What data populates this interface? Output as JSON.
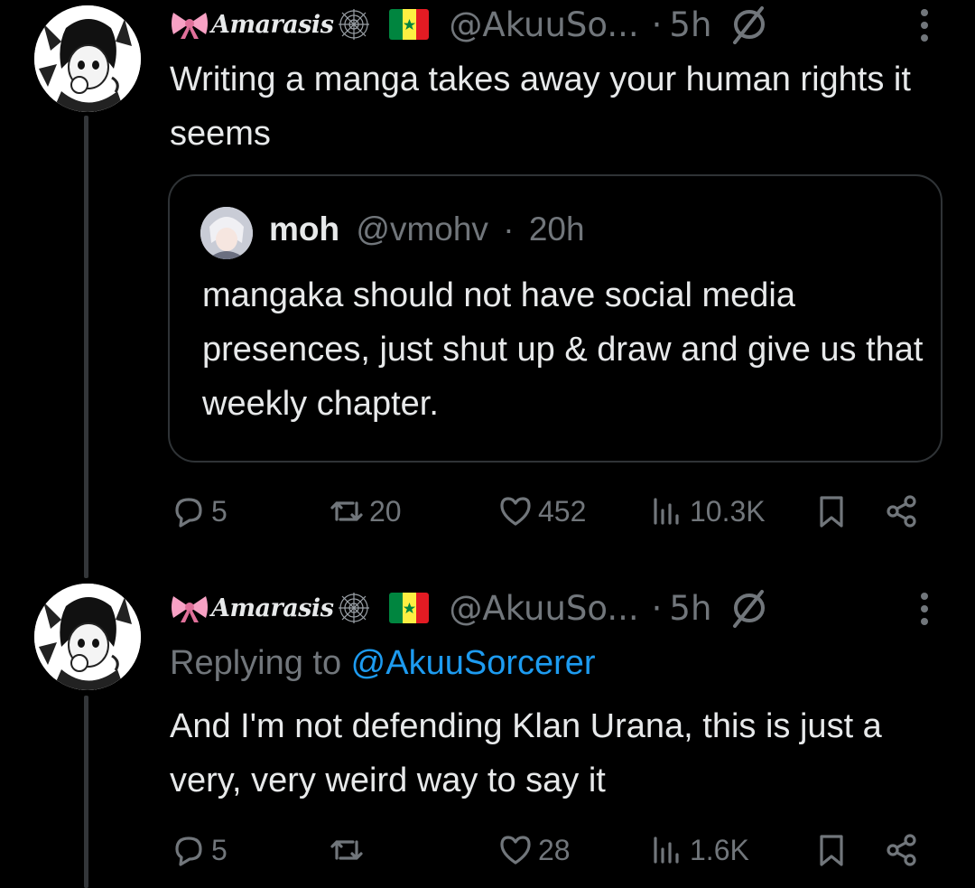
{
  "tweets": [
    {
      "display_name": "Amarasis",
      "handle": "@AkuuSo...",
      "separator": "·",
      "time": "5h",
      "text": "Writing a manga takes away your human rights it seems",
      "quote": {
        "name": "moh",
        "handle": "@vmohv",
        "separator": "·",
        "time": "20h",
        "text": "mangaka should not have social media presences, just shut up & draw and give us that weekly chapter."
      },
      "actions": {
        "replies": "5",
        "reposts": "20",
        "likes": "452",
        "views": "10.3K"
      }
    },
    {
      "display_name": "Amarasis",
      "handle": "@AkuuSo...",
      "separator": "·",
      "time": "5h",
      "replying_label": "Replying to ",
      "replying_to": "@AkuuSorcerer",
      "text": "And I'm not defending Klan Urana, this is just a very, very weird way to say it",
      "actions": {
        "replies": "5",
        "reposts": "",
        "likes": "28",
        "views": "1.6K"
      }
    }
  ],
  "colors": {
    "background": "#000000",
    "text": "#e7e9ea",
    "secondary": "#71767b",
    "link": "#1d9bf0",
    "border": "#2f3336"
  },
  "icons": [
    "bow-icon",
    "spiderweb-icon",
    "senegal-flag-icon",
    "ghost-icon",
    "more-icon",
    "reply-icon",
    "repost-icon",
    "like-icon",
    "views-icon",
    "bookmark-icon",
    "share-icon"
  ]
}
